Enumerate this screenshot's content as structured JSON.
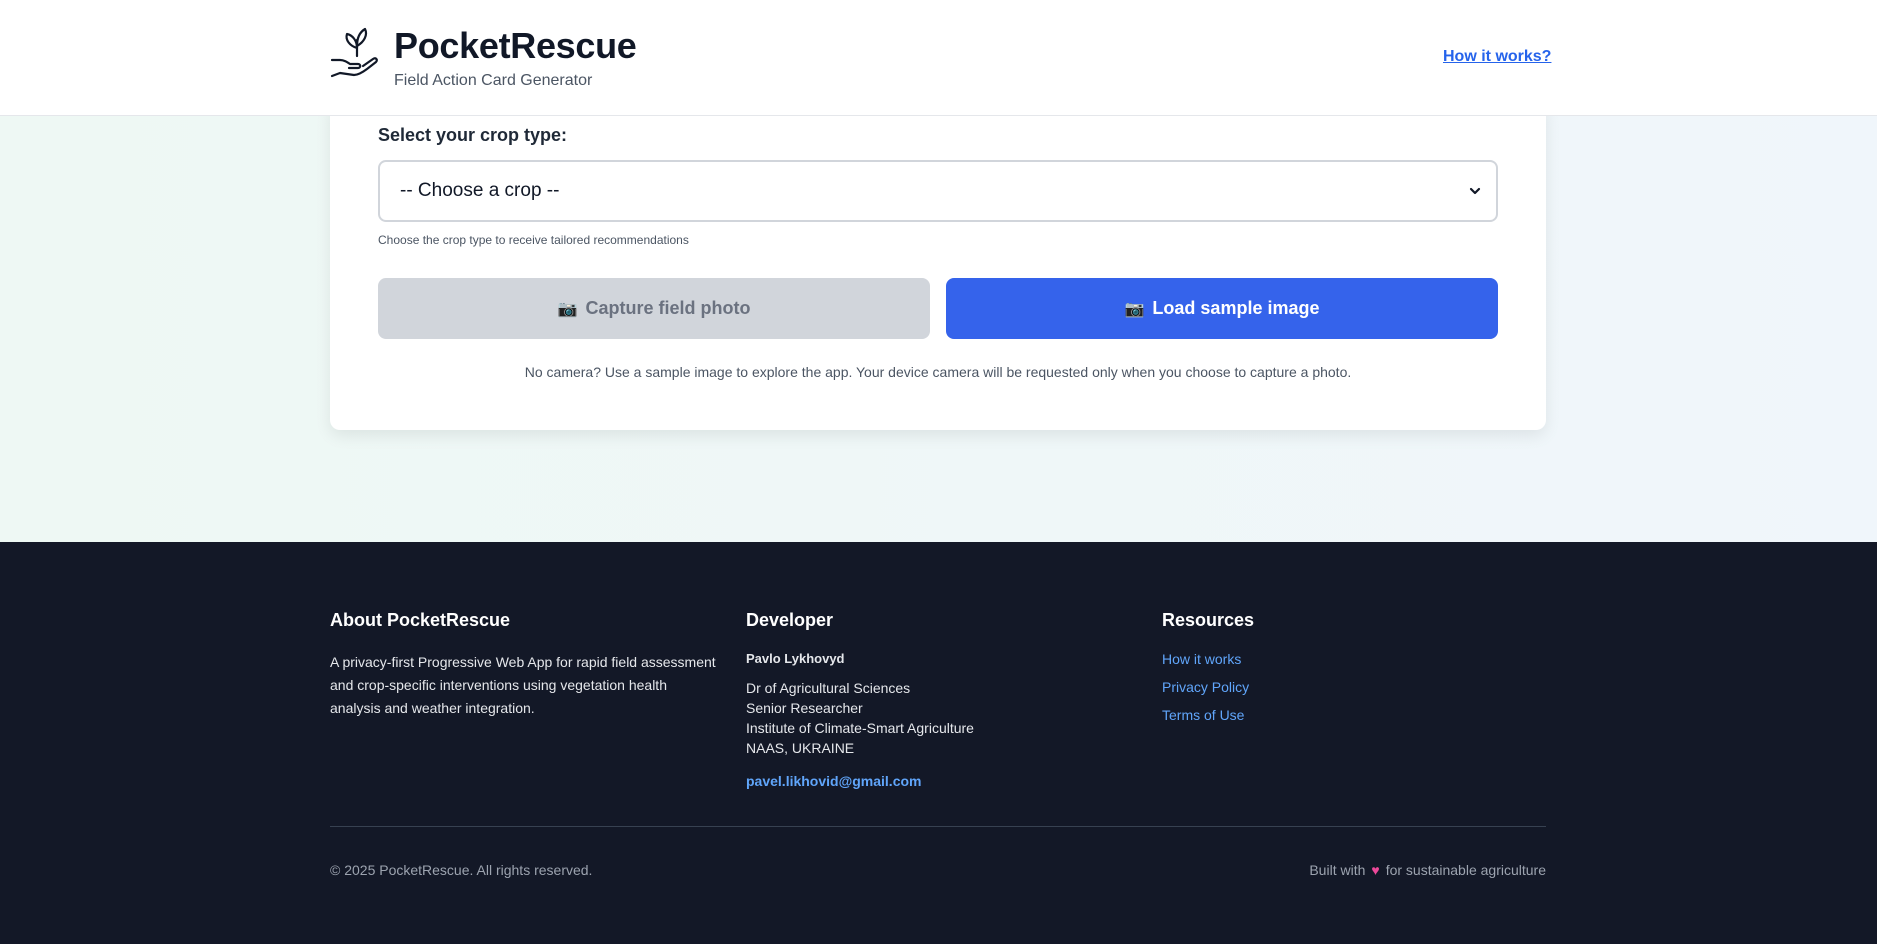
{
  "header": {
    "title": "PocketRescue",
    "subtitle": "Field Action Card Generator",
    "how_it_works": "How it works?",
    "logo_icon": "hand-sprout-icon"
  },
  "card": {
    "crop_label": "Select your crop type:",
    "crop_select_value": "-- Choose a crop --",
    "crop_hint": "Choose the crop type to receive tailored recommendations",
    "capture_button": "Capture field photo",
    "sample_button": "Load sample image",
    "camera_icon": "📷",
    "note": "No camera? Use a sample image to explore the app. Your device camera will be requested only when you choose to capture a photo."
  },
  "footer": {
    "about": {
      "heading": "About PocketRescue",
      "text": "A privacy-first Progressive Web App for rapid field assessment and crop-specific interventions using vegetation health analysis and weather integration."
    },
    "developer": {
      "heading": "Developer",
      "name": "Pavlo Lykhovyd",
      "lines": [
        "Dr of Agricultural Sciences",
        "Senior Researcher",
        "Institute of Climate-Smart Agriculture",
        "NAAS, UKRAINE"
      ],
      "email": "pavel.likhovid@gmail.com"
    },
    "resources": {
      "heading": "Resources",
      "links": [
        "How it works",
        "Privacy Policy",
        "Terms of Use"
      ]
    },
    "copyright": "© 2025 PocketRescue. All rights reserved.",
    "built_prefix": "Built with",
    "built_heart": "♥",
    "built_suffix": "for sustainable agriculture"
  },
  "colors": {
    "primary": "#3563eb",
    "link": "#60a5fa",
    "footer_bg": "#131827"
  }
}
